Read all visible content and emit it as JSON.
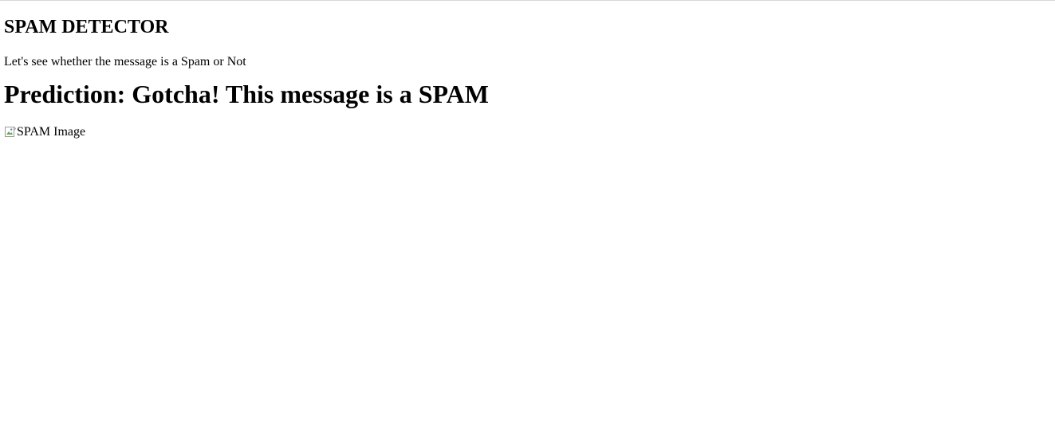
{
  "page": {
    "title": "SPAM DETECTOR",
    "subtitle": "Let's see whether the message is a Spam or Not",
    "prediction": "Prediction: Gotcha! This message is a SPAM"
  },
  "result_image": {
    "alt_text": "SPAM Image",
    "icon": "broken-image-icon"
  }
}
